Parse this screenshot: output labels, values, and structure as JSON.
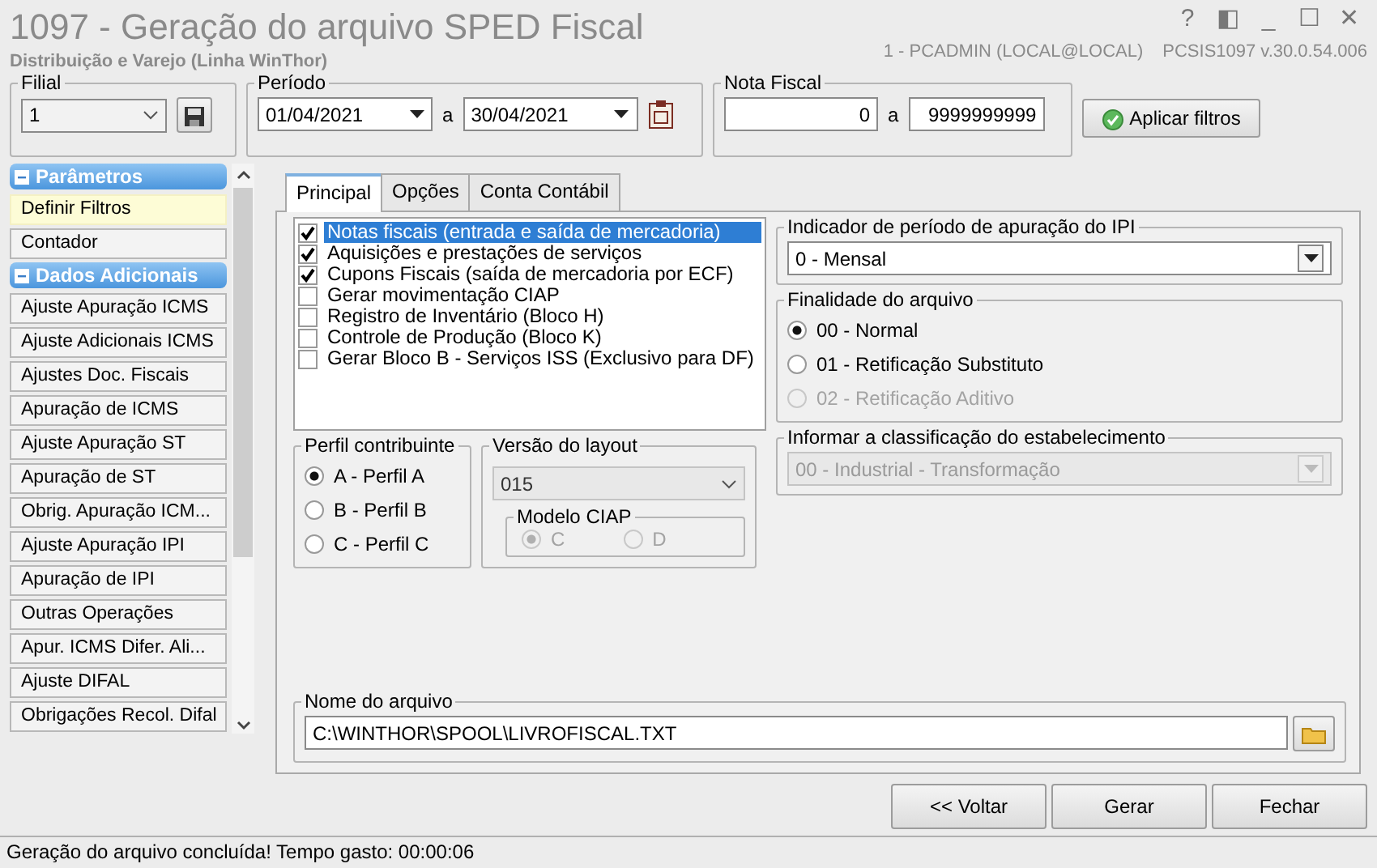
{
  "window": {
    "title": "1097 - Geração do arquivo SPED Fiscal",
    "subtitle": "Distribuição e Varejo (Linha WinThor)",
    "user": "1 - PCADMIN (LOCAL@LOCAL)",
    "program": "PCSIS1097",
    "version": "v.30.0.54.006",
    "controls": [
      "?",
      "◧",
      "_",
      "☐",
      "✕"
    ]
  },
  "filters": {
    "filial": {
      "label": "Filial",
      "value": "1"
    },
    "periodo": {
      "label": "Período",
      "from": "01/04/2021",
      "separator": "a",
      "to": "30/04/2021"
    },
    "nota_fiscal": {
      "label": "Nota Fiscal",
      "from": "0",
      "separator": "a",
      "to": "9999999999"
    },
    "apply_button": "Aplicar filtros"
  },
  "sidebar": {
    "sections": [
      {
        "title": "Parâmetros",
        "expanded": true,
        "items": [
          {
            "label": "Definir Filtros",
            "selected": true
          },
          {
            "label": "Contador",
            "selected": false
          }
        ]
      },
      {
        "title": "Dados Adicionais",
        "expanded": true,
        "items": [
          {
            "label": "Ajuste Apuração ICMS",
            "selected": false
          },
          {
            "label": "Ajuste Adicionais ICMS",
            "selected": false
          },
          {
            "label": "Ajustes Doc. Fiscais",
            "selected": false
          },
          {
            "label": "Apuração de ICMS",
            "selected": false
          },
          {
            "label": "Ajuste Apuração ST",
            "selected": false
          },
          {
            "label": "Apuração de ST",
            "selected": false
          },
          {
            "label": "Obrig. Apuração ICM...",
            "selected": false
          },
          {
            "label": "Ajuste Apuração IPI",
            "selected": false
          },
          {
            "label": "Apuração de IPI",
            "selected": false
          },
          {
            "label": "Outras Operações",
            "selected": false
          },
          {
            "label": "Apur. ICMS Difer. Ali...",
            "selected": false
          },
          {
            "label": "Ajuste DIFAL",
            "selected": false
          },
          {
            "label": "Obrigações Recol. Difal",
            "selected": false
          }
        ]
      }
    ]
  },
  "tabs": [
    {
      "label": "Principal",
      "selected": true
    },
    {
      "label": "Opções",
      "selected": false
    },
    {
      "label": "Conta Contábil",
      "selected": false
    }
  ],
  "registers": [
    {
      "label": "Notas fiscais (entrada e saída de mercadoria)",
      "checked": true,
      "selected": true
    },
    {
      "label": "Aquisições e prestações de serviços",
      "checked": true,
      "selected": false
    },
    {
      "label": "Cupons Fiscais (saída de mercadoria por ECF)",
      "checked": true,
      "selected": false
    },
    {
      "label": "Gerar movimentação CIAP",
      "checked": false,
      "selected": false
    },
    {
      "label": "Registro de Inventário (Bloco H)",
      "checked": false,
      "selected": false
    },
    {
      "label": "Controle de Produção (Bloco K)",
      "checked": false,
      "selected": false
    },
    {
      "label": "Gerar Bloco B - Serviços ISS (Exclusivo para DF)",
      "checked": false,
      "selected": false
    }
  ],
  "perfil": {
    "label": "Perfil contribuinte",
    "options": [
      {
        "label": "A - Perfil A",
        "selected": true
      },
      {
        "label": "B - Perfil B",
        "selected": false
      },
      {
        "label": "C - Perfil C",
        "selected": false
      }
    ]
  },
  "layout_version": {
    "label": "Versão do layout",
    "value": "015",
    "disabled": true
  },
  "modelo_ciap": {
    "label": "Modelo CIAP",
    "options": [
      {
        "label": "C",
        "selected": true,
        "disabled": true
      },
      {
        "label": "D",
        "selected": false,
        "disabled": true
      }
    ]
  },
  "ipi_period": {
    "label": "Indicador de período de apuração do IPI",
    "value": "0 - Mensal",
    "disabled": false
  },
  "finalidade": {
    "label": "Finalidade do arquivo",
    "options": [
      {
        "label": "00 - Normal",
        "selected": true,
        "disabled": false
      },
      {
        "label": "01 - Retificação Substituto",
        "selected": false,
        "disabled": false
      },
      {
        "label": "02 - Retificação Aditivo",
        "selected": false,
        "disabled": true
      }
    ]
  },
  "classificacao": {
    "label": "Informar a classificação do estabelecimento",
    "value": "00 - Industrial - Transformação",
    "disabled": true
  },
  "arquivo": {
    "label": "Nome do arquivo",
    "value": "C:\\WINTHOR\\SPOOL\\LIVROFISCAL.TXT"
  },
  "buttons": [
    "<< Voltar",
    "Gerar",
    "Fechar"
  ],
  "status_bar": "Geração do arquivo concluída! Tempo gasto: 00:00:06"
}
